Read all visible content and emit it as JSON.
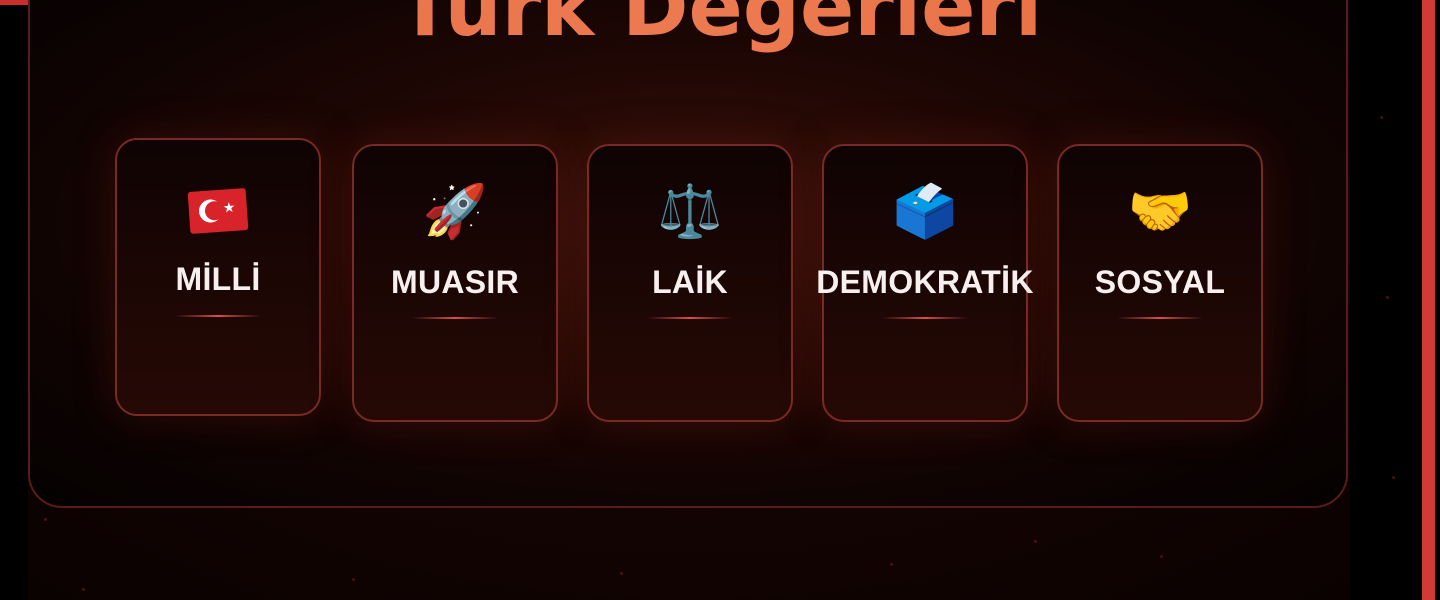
{
  "page": {
    "title": "Türk Değerleri"
  },
  "cards": [
    {
      "label": "MİLLİ",
      "icon": "turkish-flag-icon"
    },
    {
      "label": "MUASIR",
      "icon": "rocket-icon",
      "glyph": "🚀"
    },
    {
      "label": "LAİK",
      "icon": "balance-scale-icon",
      "glyph": "⚖️"
    },
    {
      "label": "DEMOKRATİK",
      "icon": "ballot-box-icon",
      "glyph": "🗳️"
    },
    {
      "label": "SOSYAL",
      "icon": "handshake-icon",
      "glyph": "🤝"
    }
  ],
  "colors": {
    "title_gradient_start": "#e8704a",
    "title_gradient_end": "#e86a3e",
    "card_border": "#7a2a24",
    "accent_red": "#d23b35",
    "background": "#000000"
  }
}
